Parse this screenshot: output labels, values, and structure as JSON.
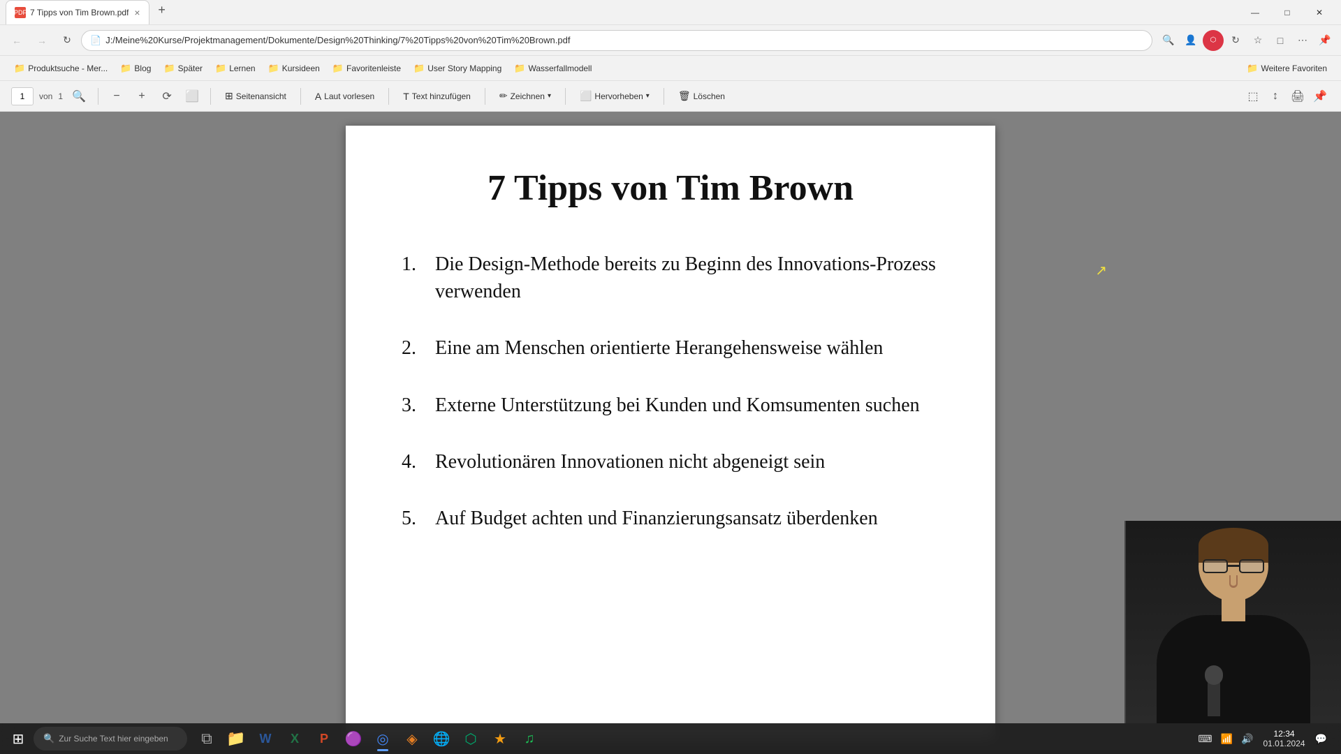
{
  "browser": {
    "tab": {
      "title": "7 Tipps von Tim Brown.pdf",
      "favicon": "pdf"
    },
    "address": "J:/Meine%20Kurse/Projektmanagement/Dokumente/Design%20Thinking/7%20Tipps%20von%20Tim%20Brown.pdf",
    "new_tab_label": "+",
    "window_controls": {
      "minimize": "—",
      "maximize": "□",
      "close": "✕"
    }
  },
  "bookmarks": [
    {
      "id": "produktsuche",
      "label": "Produktsuche - Mer...",
      "type": "folder"
    },
    {
      "id": "blog",
      "label": "Blog",
      "type": "folder"
    },
    {
      "id": "spater",
      "label": "Später",
      "type": "folder"
    },
    {
      "id": "lernen",
      "label": "Lernen",
      "type": "folder"
    },
    {
      "id": "kursideen",
      "label": "Kursideen",
      "type": "folder"
    },
    {
      "id": "favoritenleiste",
      "label": "Favoritenleiste",
      "type": "folder"
    },
    {
      "id": "user-story-mapping",
      "label": "User Story Mapping",
      "type": "folder"
    },
    {
      "id": "wasserfallmodell",
      "label": "Wasserfallmodell",
      "type": "folder"
    },
    {
      "id": "weitere-favoriten",
      "label": "Weitere Favoriten",
      "type": "more"
    }
  ],
  "pdf_toolbar": {
    "page_current": "1",
    "page_separator": "von",
    "page_total": "1",
    "zoom_minus": "−",
    "zoom_plus": "+",
    "zoom_reset": "⟳",
    "fit_page": "⬜",
    "seitenansicht_label": "Seitenansicht",
    "laut_vorlesen_label": "Laut vorlesen",
    "text_hinzufugen_label": "Text hinzufügen",
    "zeichnen_label": "Zeichnen",
    "hervorheben_label": "Hervorheben",
    "loschen_label": "Löschen"
  },
  "pdf_content": {
    "title": "7 Tipps von Tim Brown",
    "items": [
      {
        "number": "1.",
        "text": "Die Design-Methode bereits zu Beginn des Innovations-Prozess verwenden"
      },
      {
        "number": "2.",
        "text": "Eine am Menschen orientierte Herangehensweise wählen"
      },
      {
        "number": "3.",
        "text": "Externe Unterstützung bei Kunden und Komsumenten suchen"
      },
      {
        "number": "4.",
        "text": "Revolutionären Innovationen nicht abgeneigt sein"
      },
      {
        "number": "5.",
        "text": "Auf Budget achten und Finanzierungsansatz überdenken"
      }
    ]
  },
  "taskbar": {
    "search_placeholder": "Zur Suche Text hier eingeben",
    "apps": [
      {
        "id": "windows",
        "icon": "⊞",
        "label": "Start"
      },
      {
        "id": "taskview",
        "icon": "❑",
        "label": "Task View"
      },
      {
        "id": "explorer",
        "icon": "📁",
        "label": "Explorer"
      },
      {
        "id": "word",
        "icon": "W",
        "label": "Word"
      },
      {
        "id": "excel",
        "icon": "X",
        "label": "Excel"
      },
      {
        "id": "powerpoint",
        "icon": "P",
        "label": "PowerPoint"
      },
      {
        "id": "app5",
        "icon": "🟣",
        "label": "App5"
      },
      {
        "id": "chrome",
        "icon": "◎",
        "label": "Chrome"
      },
      {
        "id": "app7",
        "icon": "🔶",
        "label": "App7"
      },
      {
        "id": "app8",
        "icon": "🔵",
        "label": "App8"
      },
      {
        "id": "app9",
        "icon": "🟢",
        "label": "App9"
      },
      {
        "id": "app10",
        "icon": "★",
        "label": "App10"
      },
      {
        "id": "spotify",
        "icon": "♫",
        "label": "Spotify"
      }
    ],
    "clock": {
      "time": "12:34",
      "date": "01.01.2024"
    }
  }
}
